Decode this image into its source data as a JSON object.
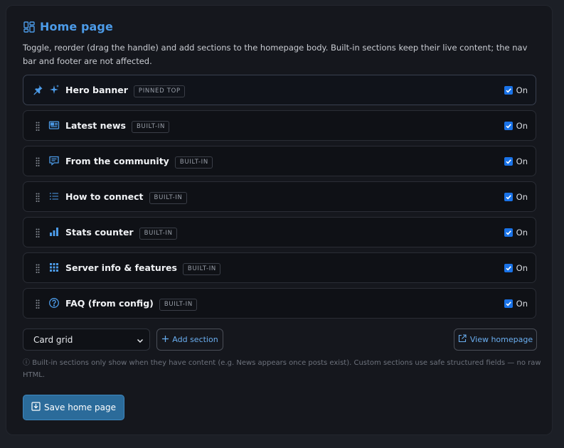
{
  "header": {
    "title": "Home page",
    "icon": "layout-icon"
  },
  "description": "Toggle, reorder (drag the handle) and add sections to the homepage body. Built-in sections keep their live content; the nav bar and footer are not affected.",
  "sections": [
    {
      "label": "Hero banner",
      "badge": "PINNED TOP",
      "icon": "sparkle-icon",
      "pinned": true,
      "enabled": true,
      "toggle_label": "On"
    },
    {
      "label": "Latest news",
      "badge": "BUILT-IN",
      "icon": "newspaper-icon",
      "enabled": true,
      "toggle_label": "On"
    },
    {
      "label": "From the community",
      "badge": "BUILT-IN",
      "icon": "chat-icon",
      "enabled": true,
      "toggle_label": "On"
    },
    {
      "label": "How to connect",
      "badge": "BUILT-IN",
      "icon": "list-icon",
      "enabled": true,
      "toggle_label": "On"
    },
    {
      "label": "Stats counter",
      "badge": "BUILT-IN",
      "icon": "bar-chart-icon",
      "enabled": true,
      "toggle_label": "On"
    },
    {
      "label": "Server info & features",
      "badge": "BUILT-IN",
      "icon": "grid-icon",
      "enabled": true,
      "toggle_label": "On"
    },
    {
      "label": "FAQ (from config)",
      "badge": "BUILT-IN",
      "icon": "question-icon",
      "enabled": true,
      "toggle_label": "On"
    }
  ],
  "controls": {
    "section_type_selected": "Card grid",
    "add_section_label": "Add section",
    "view_homepage_label": "View homepage"
  },
  "note": "Built-in sections only show when they have content (e.g. News appears once posts exist). Custom sections use safe structured fields — no raw HTML.",
  "save_label": "Save home page",
  "colors": {
    "accent": "#4c9be8",
    "checkbox": "#1a73e8",
    "save_button": "#2b6b9a"
  }
}
